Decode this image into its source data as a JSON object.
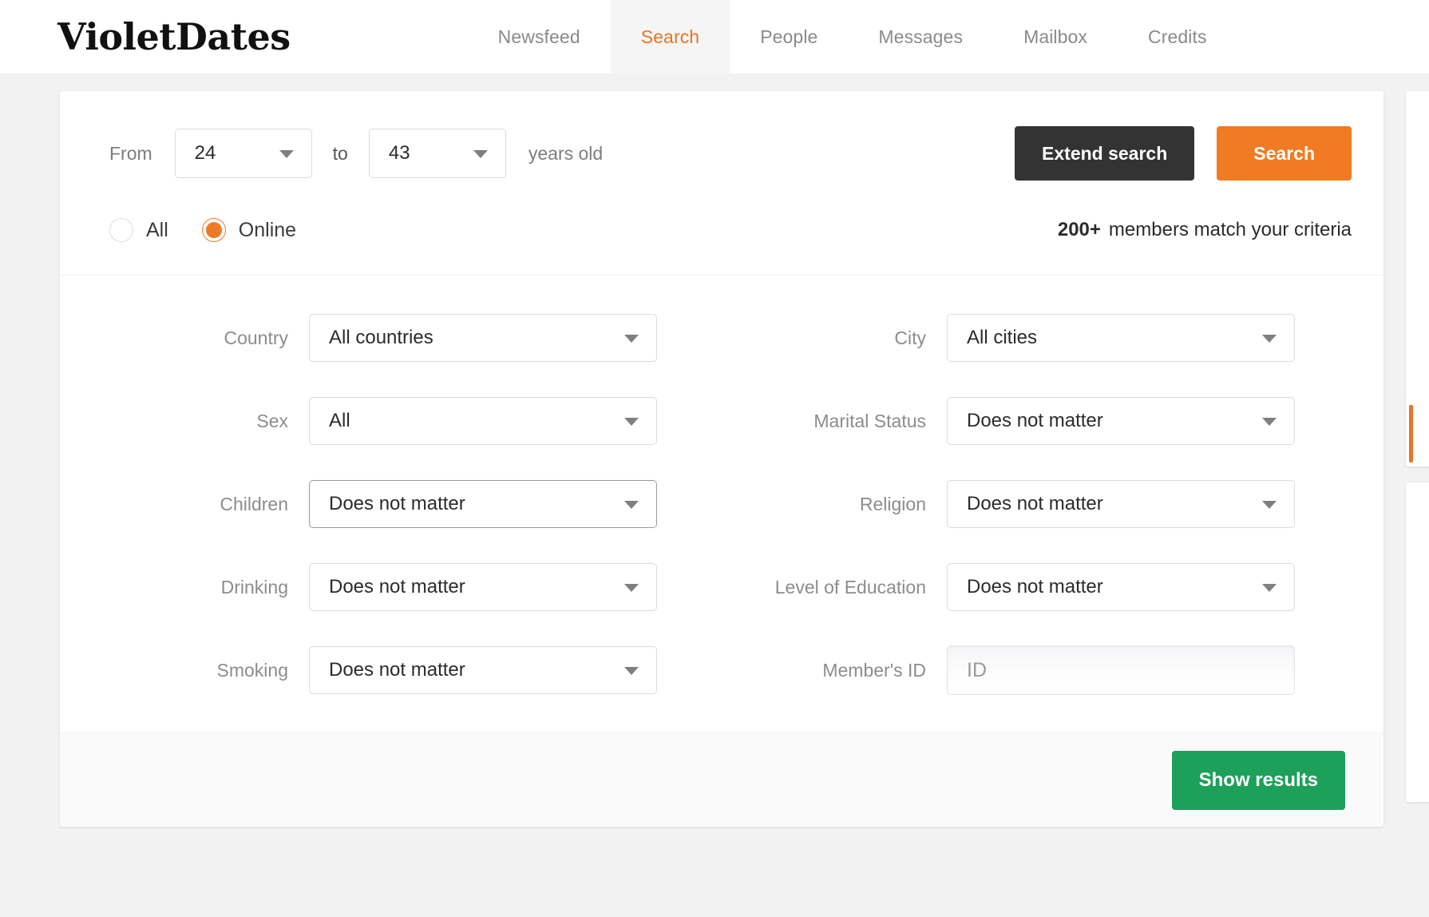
{
  "brand": {
    "logo": "VioletDates"
  },
  "nav": {
    "items": [
      {
        "label": "Newsfeed",
        "active": false
      },
      {
        "label": "Search",
        "active": true
      },
      {
        "label": "People",
        "active": false
      },
      {
        "label": "Messages",
        "active": false
      },
      {
        "label": "Mailbox",
        "active": false
      },
      {
        "label": "Credits",
        "active": false
      }
    ]
  },
  "age": {
    "from_label": "From",
    "from_value": "24",
    "to_label": "to",
    "to_value": "43",
    "unit_label": "years old"
  },
  "actions": {
    "extend_search": "Extend search",
    "search": "Search",
    "show_results": "Show results"
  },
  "online_filter": {
    "all_label": "All",
    "online_label": "Online",
    "selected": "Online"
  },
  "match": {
    "count": "200+",
    "text": "members match your criteria"
  },
  "fields": {
    "country": {
      "label": "Country",
      "value": "All countries"
    },
    "city": {
      "label": "City",
      "value": "All cities"
    },
    "sex": {
      "label": "Sex",
      "value": "All"
    },
    "marital_status": {
      "label": "Marital Status",
      "value": "Does not matter"
    },
    "children": {
      "label": "Children",
      "value": "Does not matter"
    },
    "religion": {
      "label": "Religion",
      "value": "Does not matter"
    },
    "drinking": {
      "label": "Drinking",
      "value": "Does not matter"
    },
    "education": {
      "label": "Level of Education",
      "value": "Does not matter"
    },
    "smoking": {
      "label": "Smoking",
      "value": "Does not matter"
    },
    "member_id": {
      "label": "Member's ID",
      "value": "",
      "placeholder": "ID"
    }
  },
  "colors": {
    "accent_orange": "#f07b22",
    "nav_active": "#ea7423",
    "dark_button": "#333333",
    "green_button": "#1ca05a",
    "page_bg": "#f2f2f2"
  }
}
